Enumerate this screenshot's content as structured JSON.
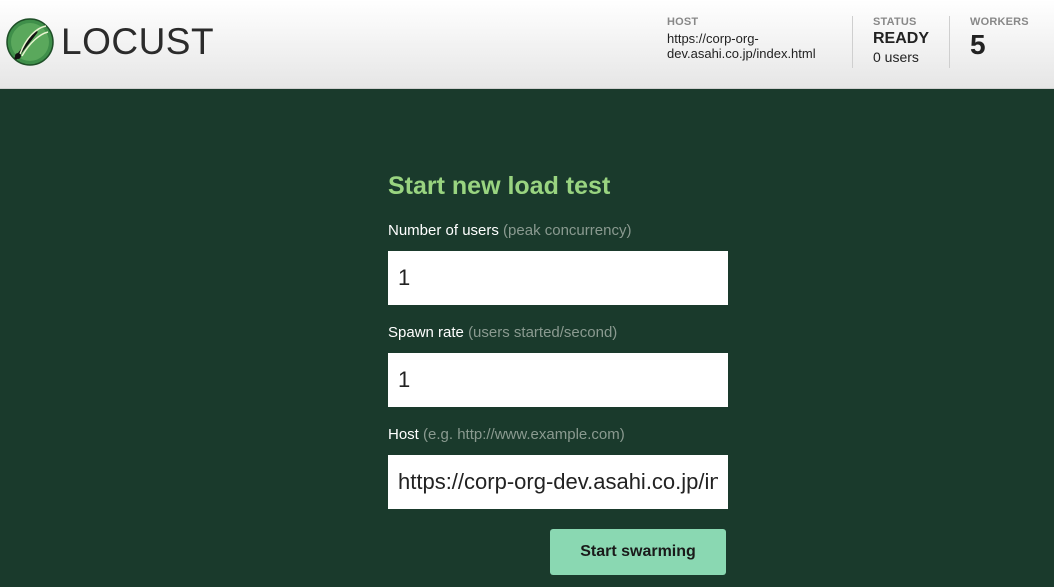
{
  "header": {
    "logo_text": "LOCUST",
    "host": {
      "label": "HOST",
      "value": "https://corp-org-dev.asahi.co.jp/index.html"
    },
    "status": {
      "label": "STATUS",
      "value": "READY",
      "users": "0 users"
    },
    "workers": {
      "label": "WORKERS",
      "value": "5"
    }
  },
  "form": {
    "title": "Start new load test",
    "users": {
      "label": "Number of users",
      "hint": "(peak concurrency)",
      "value": "1"
    },
    "spawn_rate": {
      "label": "Spawn rate",
      "hint": "(users started/second)",
      "value": "1"
    },
    "host": {
      "label": "Host",
      "hint": "(e.g. http://www.example.com)",
      "value": "https://corp-org-dev.asahi.co.jp/index.html"
    },
    "submit_label": "Start swarming"
  },
  "colors": {
    "background": "#1a3a2c",
    "title_green": "#99d480",
    "button": "#8ad8b2"
  }
}
